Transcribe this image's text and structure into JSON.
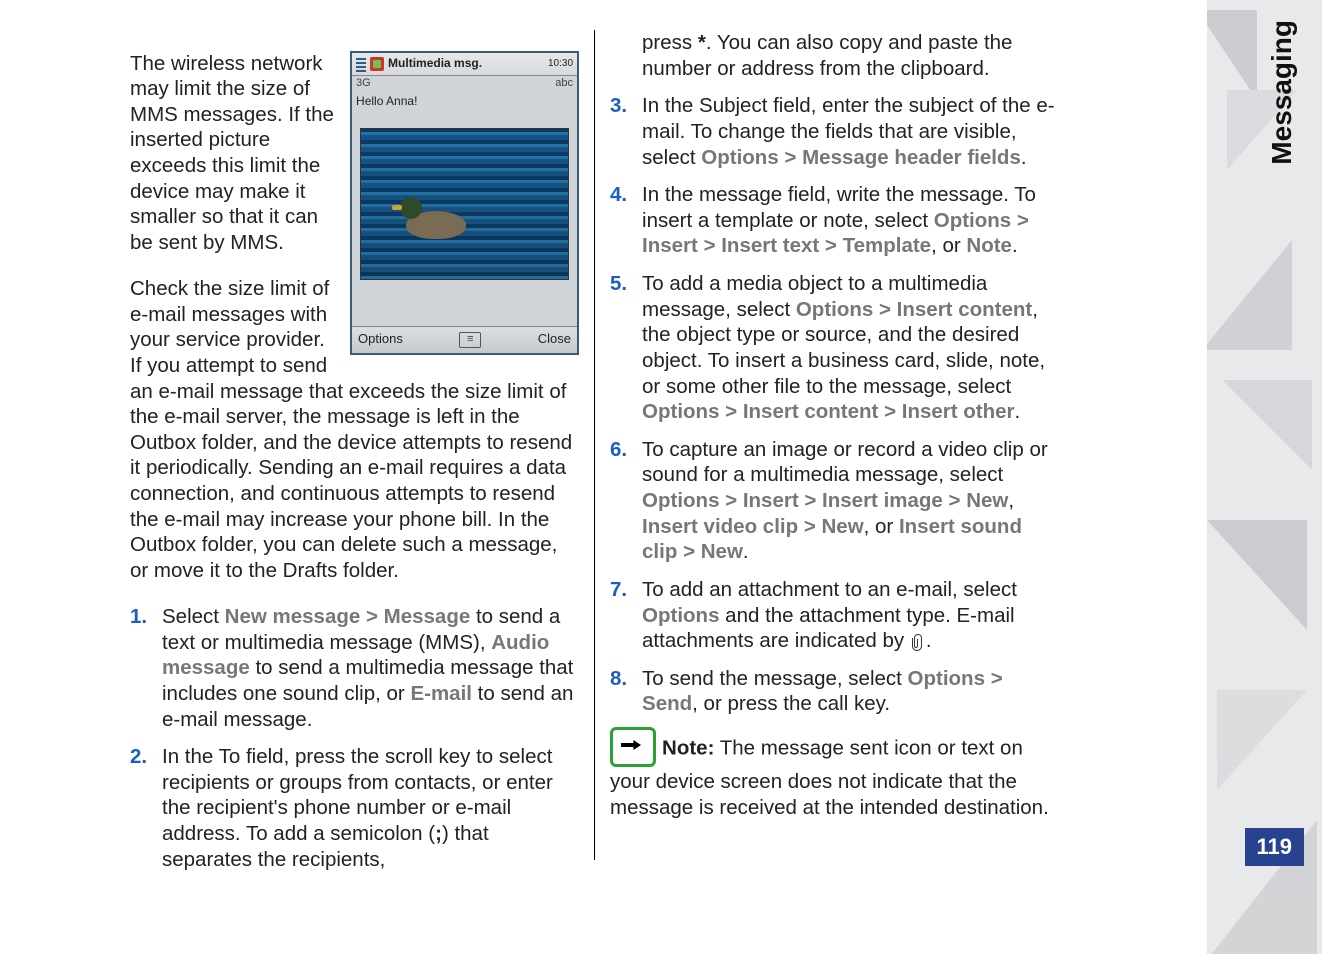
{
  "section": "Messaging",
  "page_number": "119",
  "screenshot": {
    "title": "Multimedia msg.",
    "clock": "10:30",
    "net": "3G",
    "input_mode": "abc",
    "greeting": "Hello Anna!",
    "soft_left": "Options",
    "soft_right": "Close"
  },
  "left": {
    "para1": "The wireless network may limit the size of MMS messages. If the inserted picture exceeds this limit the device may make it smaller so that it can be sent by MMS.",
    "para2a": "Check the size limit of e-mail messages with your service provider. If you attempt to send an e-mail message that exceeds the",
    "para2b": "size limit of the e-mail server, the message is left in the Outbox folder, and the device attempts to resend it periodically. Sending an e-mail requires a data connection, and continuous attempts to resend the e-mail may increase your phone bill. In the Outbox folder, you can delete such a message, or move it to the Drafts folder.",
    "step1_a": "Select ",
    "step1_new_message": "New message",
    "step1_b": " ",
    "step1_message": "Message",
    "step1_c": " to send a text or multimedia message (MMS), ",
    "step1_audio": "Audio message",
    "step1_d": " to send a multimedia message that includes one sound clip, or ",
    "step1_email": "E-mail",
    "step1_e": " to send an e-mail message.",
    "step2_a": "In the To field, press the scroll key to select recipients or groups from contacts, or enter the recipient's phone number or e-mail address. To add a semicolon (",
    "step2_semi": ";",
    "step2_b": ") that separates the recipients,"
  },
  "right": {
    "step2_c": "press ",
    "step2_star": "*",
    "step2_d": ". You can also copy and paste the number or address from the clipboard.",
    "step3_a": "In the Subject field, enter the subject of the e-mail. To change the fields that are visible, select ",
    "step3_b": "Message header fields",
    "step3_c": ".",
    "step4_a": "In the message field, write the message. To insert a template or note, select ",
    "step4_insert": "Insert",
    "step4_inserttext": "Insert text",
    "step4_template": "Template",
    "step4_b": ", or ",
    "step4_note": "Note",
    "step4_c": ".",
    "step5_a": "To add a media object to a multimedia message, select ",
    "step5_insertcontent": "Insert content",
    "step5_b": ", the object type or source, and the desired object. To insert a business card, slide, note, or some other file to the message, select ",
    "step5_insertother": "Insert other",
    "step5_c": ".",
    "step6_a": "To capture an image or record a video clip or sound for a multimedia message, select ",
    "step6_insertimage": "Insert image",
    "step6_new": "New",
    "step6_b": ", ",
    "step6_ivc": "Insert video clip",
    "step6_c": ", or ",
    "step6_isc": "Insert sound clip",
    "step6_d": ".",
    "step7_a": "To add an attachment to an e-mail, select ",
    "step7_b": " and the attachment type. E-mail attachments are indicated by ",
    "step7_c": ".",
    "step8_a": "To send the message, select ",
    "step8_send": "Send",
    "step8_b": ", or press the call key.",
    "note_label": "Note:",
    "note_text": " The message sent icon or text on your device screen does not indicate that the message is received at the intended destination.",
    "options": "Options",
    "gt": ">"
  }
}
